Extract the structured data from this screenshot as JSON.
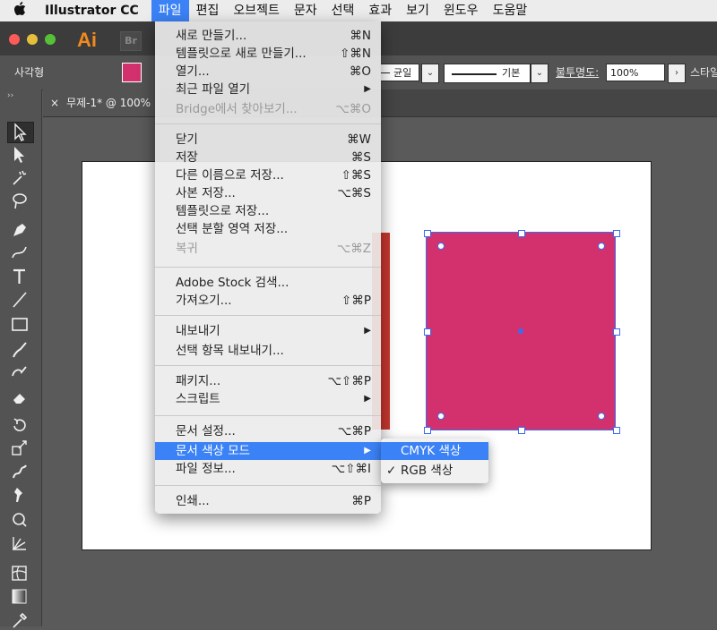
{
  "menubar": {
    "app_name": "Illustrator CC",
    "items": [
      "파일",
      "편집",
      "오브젝트",
      "문자",
      "선택",
      "효과",
      "보기",
      "윈도우",
      "도움말"
    ],
    "active_index": 0
  },
  "app": {
    "logo": "Ai",
    "bridge": "Br"
  },
  "controlbar": {
    "shape_label": "사각형",
    "fill_color": "#d3316d",
    "stroke_profile": "균일",
    "brush": "기본",
    "opacity_label": "불투명도:",
    "opacity_value": "100%",
    "style_label": "스타일"
  },
  "document_tab": {
    "title": "무제-1* @ 100%"
  },
  "file_menu": {
    "items": [
      {
        "label": "새로 만들기...",
        "shortcut": "⌘N"
      },
      {
        "label": "템플릿으로 새로 만들기...",
        "shortcut": "⇧⌘N"
      },
      {
        "label": "열기...",
        "shortcut": "⌘O"
      },
      {
        "label": "최근 파일 열기",
        "shortcut": "▶"
      },
      {
        "label": "Bridge에서 찾아보기...",
        "shortcut": "⌥⌘O",
        "disabled": true
      },
      {
        "label": "닫기",
        "shortcut": "⌘W"
      },
      {
        "label": "저장",
        "shortcut": "⌘S"
      },
      {
        "label": "다른 이름으로 저장...",
        "shortcut": "⇧⌘S"
      },
      {
        "label": "사본 저장...",
        "shortcut": "⌥⌘S"
      },
      {
        "label": "템플릿으로 저장...",
        "shortcut": ""
      },
      {
        "label": "선택 분할 영역 저장...",
        "shortcut": ""
      },
      {
        "label": "복귀",
        "shortcut": "⌥⌘Z",
        "disabled": true
      },
      {
        "label": "Adobe Stock 검색...",
        "shortcut": ""
      },
      {
        "label": "가져오기...",
        "shortcut": "⇧⌘P"
      },
      {
        "label": "내보내기",
        "shortcut": "▶"
      },
      {
        "label": "선택 항목 내보내기...",
        "shortcut": ""
      },
      {
        "label": "패키지...",
        "shortcut": "⌥⇧⌘P"
      },
      {
        "label": "스크립트",
        "shortcut": "▶"
      },
      {
        "label": "문서 설정...",
        "shortcut": "⌥⌘P"
      },
      {
        "label": "문서 색상 모드",
        "shortcut": "▶",
        "highlighted": true
      },
      {
        "label": "파일 정보...",
        "shortcut": "⌥⇧⌘I"
      },
      {
        "label": "인쇄...",
        "shortcut": "⌘P"
      }
    ]
  },
  "color_mode_submenu": {
    "items": [
      {
        "label": "CMYK 색상",
        "checked": false,
        "highlighted": true
      },
      {
        "label": "RGB 색상",
        "checked": true,
        "highlighted": false
      }
    ],
    "check_glyph": "✓"
  },
  "canvas": {
    "square_color": "#d3316d",
    "side_shape_color": "#c7372f"
  },
  "icons": [
    "apple-icon",
    "close-window-icon",
    "minimize-window-icon",
    "zoom-window-icon",
    "selection-tool-icon",
    "direct-selection-tool-icon",
    "magic-wand-icon",
    "lasso-icon",
    "pen-tool-icon",
    "curvature-icon",
    "type-tool-icon",
    "line-tool-icon",
    "rectangle-tool-icon",
    "paintbrush-icon",
    "shaper-icon",
    "eraser-icon",
    "rotate-icon",
    "scale-icon",
    "width-tool-icon",
    "puppet-warp-icon",
    "free-transform-icon",
    "perspective-icon",
    "mesh-icon",
    "gradient-icon",
    "eyedropper-icon"
  ]
}
